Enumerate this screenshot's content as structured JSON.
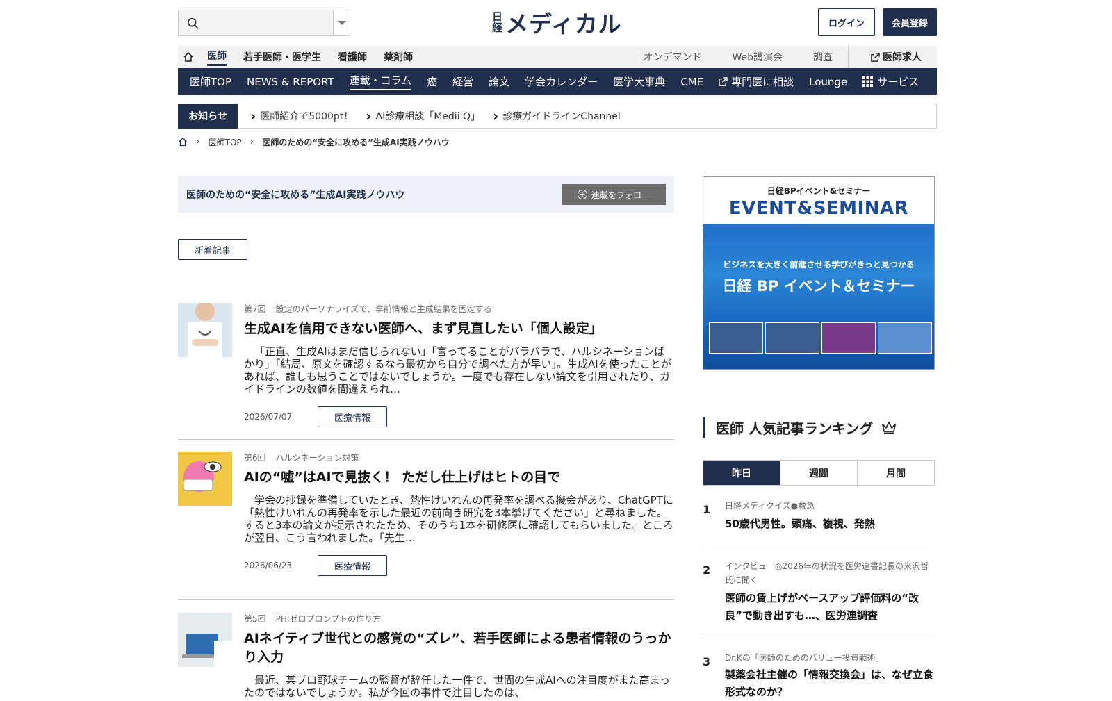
{
  "search": {
    "placeholder": ""
  },
  "logo": {
    "nikkei_top": "日",
    "nikkei_bottom": "経",
    "medical": "メディカル"
  },
  "header": {
    "login": "ログイン",
    "register": "会員登録"
  },
  "subnav": {
    "items": [
      "医師",
      "若手医師・医学生",
      "看護師",
      "薬剤師"
    ],
    "right": [
      "オンデマンド",
      "Web講演会",
      "調査"
    ],
    "job": "医師求人"
  },
  "mainnav": [
    "医師TOP",
    "NEWS & REPORT",
    "連載・コラム",
    "癌",
    "経営",
    "論文",
    "学会カレンダー",
    "医学大事典",
    "CME",
    "専門医に相談",
    "Lounge",
    "サービス"
  ],
  "notice": {
    "tag": "お知らせ",
    "items": [
      "医師紹介で5000pt！",
      "AI診療相談「Medii Q」",
      "診療ガイドラインChannel"
    ]
  },
  "breadcrumb": {
    "top": "医師TOP",
    "current": "医師のための“安全に攻める”生成AI実践ノウハウ"
  },
  "series": {
    "title": "医師のための“安全に攻める”生成AI実践ノウハウ",
    "follow": "連載をフォロー"
  },
  "new_articles": "新着記事",
  "articles": [
    {
      "no": "第7回",
      "subtitle": "設定のパーソナライズで、事前情報と生成結果を固定する",
      "title": "生成AIを信用できない医師へ、まず見直したい「個人設定」",
      "desc": "「正直、生成AIはまだ信じられない」「言ってることがバラバラで、ハルシネーションばかり」「結局、原文を確認するなら最初から自分で調べた方が早い」。生成AIを使ったことがあれば、誰しも思うことではないでしょうか。一度でも存在しない論文を引用されたり、ガイドラインの数値を間違えられ…",
      "date": "2026/07/07",
      "category": "医療情報"
    },
    {
      "no": "第6回",
      "subtitle": "ハルシネーション対策",
      "title": "AIの“嘘”はAIで見抜く！ ただし仕上げはヒトの目で",
      "desc": "学会の抄録を準備していたとき、熱性けいれんの再発率を調べる機会があり、ChatGPTに「熱性けいれんの再発率を示した最近の前向き研究を3本挙げてください」と尋ねました。すると3本の論文が提示されたため、そのうち1本を研修医に確認してもらいました。ところが翌日、こう言われました。「先生…",
      "date": "2026/06/23",
      "category": "医療情報"
    },
    {
      "no": "第5回",
      "subtitle": "PHIゼロプロンプトの作り方",
      "title": "AIネイティブ世代との感覚の“ズレ”、若手医師による患者情報のうっかり入力",
      "desc": "最近、某プロ野球チームの監督が辞任した一件で、世間の生成AIへの注目度がまた高まったのではないでしょうか。私が今回の事件で注目したのは、",
      "date": "",
      "category": ""
    }
  ],
  "ad": {
    "t1": "日経BPイベント&セミナー",
    "t2": "EVENT&SEMINAR",
    "b1": "ビジネスを大きく前進させる学びがきっと見つかる",
    "b2": "日経 BP イベント＆セミナー"
  },
  "ranking": {
    "title": "医師 人気記事ランキング",
    "tabs": [
      "昨日",
      "週間",
      "月間"
    ],
    "items": [
      {
        "num": "1",
        "meta": "日経メディクイズ●救急",
        "title": "50歳代男性。頭痛、複視、発熱"
      },
      {
        "num": "2",
        "meta": "インタビュー◎2026年の状況を医労連書記長の米沢哲氏に聞く",
        "title": "医師の賃上げがベースアップ評価料の“改良”で動き出すも…、医労連調査"
      },
      {
        "num": "3",
        "meta": "Dr.Kの「医師のためのバリュー投資戦術」",
        "title": "製薬会社主催の「情報交換会」は、なぜ立食形式なのか？"
      }
    ]
  },
  "colors": {
    "navy": "#1f2f4d",
    "accent_blue": "#1a4c9a"
  }
}
